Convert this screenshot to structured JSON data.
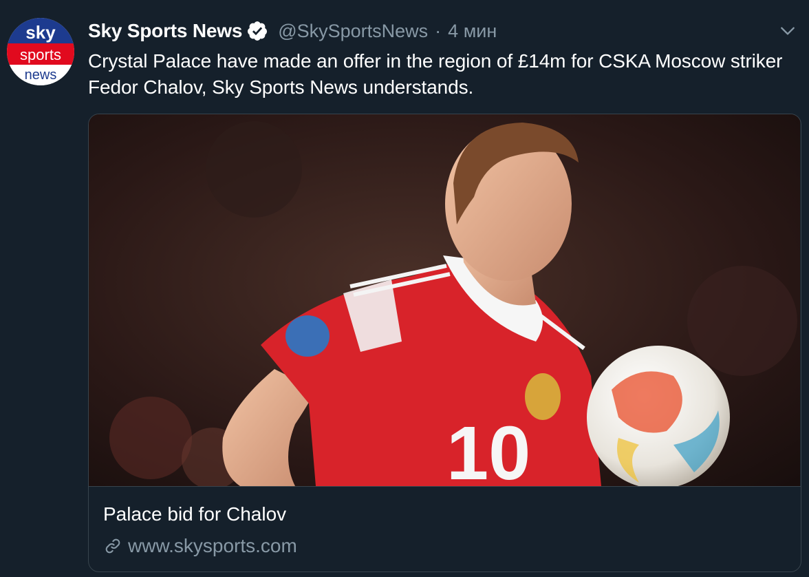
{
  "author": {
    "display_name": "Sky Sports News",
    "handle": "@SkySportsNews",
    "separator": "·",
    "time": "4 мин",
    "verified": true,
    "avatar": {
      "logo_line1": "sky",
      "logo_line2": "sports",
      "logo_line3": "news"
    }
  },
  "tweet": {
    "text": "Crystal Palace have made an offer in the region of £14m for CSKA Moscow striker Fedor Chalov, Sky Sports News understands."
  },
  "card": {
    "title": "Palace bid for Chalov",
    "domain": "www.skysports.com",
    "image_description": "photo-football-player",
    "shirt_number": "10"
  },
  "icons": {
    "verified": "verified-badge-icon",
    "caret": "chevron-down-icon",
    "link": "link-icon"
  },
  "colors": {
    "background": "#15202b",
    "secondary_text": "#8899a6",
    "border": "#38444d",
    "sky_red": "#e10a1e",
    "sky_blue": "#1f3a93"
  }
}
